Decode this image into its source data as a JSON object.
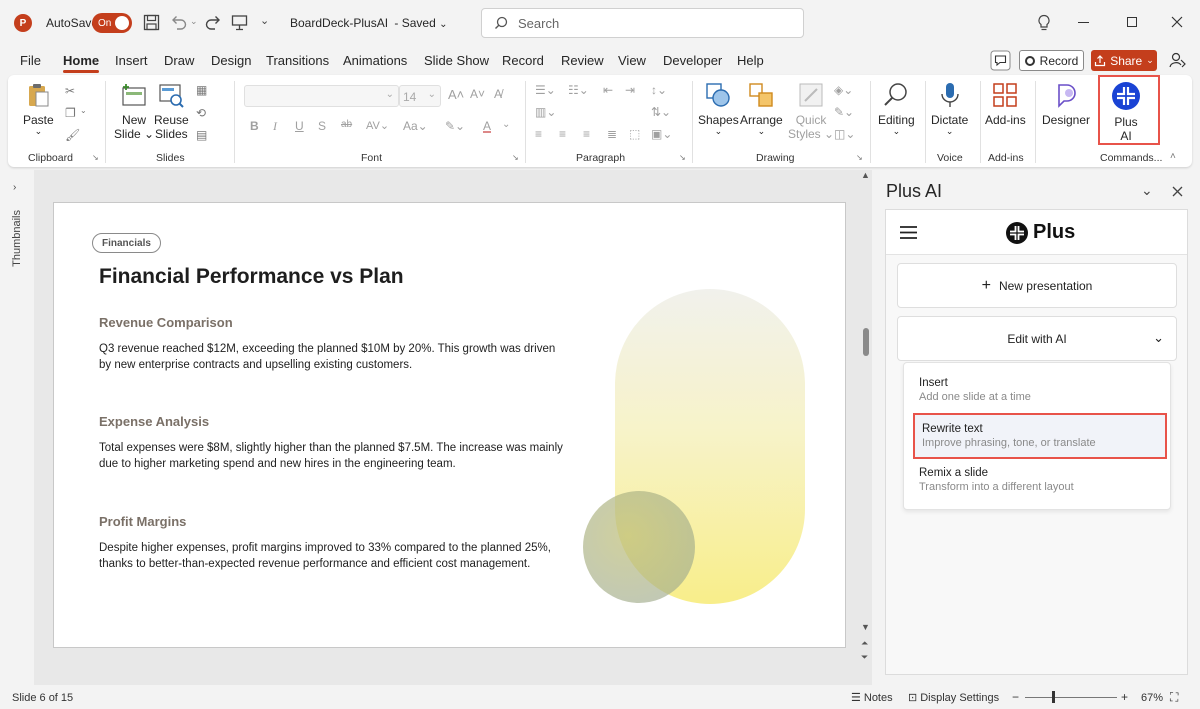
{
  "titlebar": {
    "autosave_label": "AutoSave",
    "autosave_state": "On",
    "doc_title": "BoardDeck-PlusAI",
    "doc_status": "Saved",
    "search_placeholder": "Search"
  },
  "menu": {
    "tabs": [
      "File",
      "Home",
      "Insert",
      "Draw",
      "Design",
      "Transitions",
      "Animations",
      "Slide Show",
      "Record",
      "Review",
      "View",
      "Developer",
      "Help"
    ],
    "active": "Home",
    "record_label": "Record",
    "share_label": "Share"
  },
  "ribbon": {
    "groups": {
      "clipboard": "Clipboard",
      "slides": "Slides",
      "font": "Font",
      "paragraph": "Paragraph",
      "drawing": "Drawing",
      "voice": "Voice",
      "addins": "Add-ins",
      "commands": "Commands..."
    },
    "paste": "Paste",
    "new_slide_1": "New",
    "new_slide_2": "Slide",
    "reuse_1": "Reuse",
    "reuse_2": "Slides",
    "font_size": "14",
    "shapes": "Shapes",
    "arrange": "Arrange",
    "quick_1": "Quick",
    "quick_2": "Styles",
    "editing": "Editing",
    "dictate": "Dictate",
    "addins": "Add-ins",
    "designer": "Designer",
    "plus_1": "Plus",
    "plus_2": "AI",
    "accent_color": "#c43e1c",
    "highlight_color": "#e8534a"
  },
  "thumbnails_label": "Thumbnails",
  "slide": {
    "tag": "Financials",
    "title": "Financial Performance vs Plan",
    "sections": [
      {
        "heading": "Revenue Comparison",
        "body": "Q3 revenue reached $12M, exceeding the planned $10M by 20%. This growth was driven by new enterprise contracts and upselling existing customers."
      },
      {
        "heading": "Expense Analysis",
        "body": "Total expenses were $8M, slightly higher than the planned $7.5M. The increase was mainly due to higher marketing spend and new hires in the engineering team."
      },
      {
        "heading": "Profit Margins",
        "body": "Despite higher expenses, profit margins improved to 33% compared to the planned 25%, thanks to better-than-expected revenue performance and efficient cost management."
      }
    ]
  },
  "panel": {
    "title": "Plus AI",
    "brand": "Plus",
    "new_presentation": "New presentation",
    "edit_with_ai": "Edit with AI",
    "options": [
      {
        "title": "Insert",
        "desc": "Add one slide at a time"
      },
      {
        "title": "Rewrite text",
        "desc": "Improve phrasing, tone, or translate"
      },
      {
        "title": "Remix a slide",
        "desc": "Transform into a different layout"
      }
    ]
  },
  "status": {
    "slide_info": "Slide 6 of 15",
    "notes": "Notes",
    "display_settings": "Display Settings",
    "zoom": "67%"
  }
}
